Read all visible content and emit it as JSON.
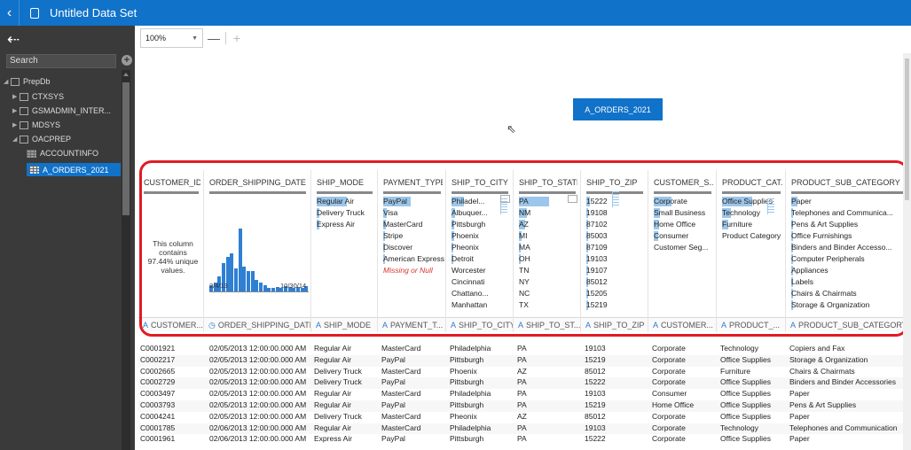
{
  "window": {
    "title": "Untitled Data Set"
  },
  "left_panel": {
    "search_placeholder": "Search",
    "tree": [
      {
        "label": "PrepDb",
        "type": "db",
        "expanded": true
      },
      {
        "label": "CTXSYS",
        "type": "schema"
      },
      {
        "label": "GSMADMIN_INTER...",
        "type": "schema"
      },
      {
        "label": "MDSYS",
        "type": "schema"
      },
      {
        "label": "OACPREP",
        "type": "schema",
        "expanded": true
      },
      {
        "label": "ACCOUNTINFO",
        "type": "table"
      },
      {
        "label": "A_ORDERS_2021",
        "type": "table",
        "selected": true
      }
    ]
  },
  "toolbar": {
    "zoom": "100%",
    "zoom_out": "—",
    "zoom_in": "+"
  },
  "diagram": {
    "node_label": "A_ORDERS_2021"
  },
  "profile": {
    "columns": [
      {
        "header": "CUSTOMER_ID",
        "footer": "CUSTOMER...",
        "type_icon": "A",
        "unique_note": "This column contains 97.44% unique values."
      },
      {
        "header": "ORDER_SHIPPING_DATE",
        "footer": "ORDER_SHIPPING_DATE",
        "type_icon": "◷",
        "histogram": {
          "start_label": "2/4/13",
          "end_label": "10/30/14",
          "values": [
            0.1,
            0.14,
            0.24,
            0.44,
            0.52,
            0.58,
            0.36,
            0.95,
            0.38,
            0.31,
            0.31,
            0.18,
            0.14,
            0.1,
            0.06,
            0.06,
            0.08,
            0.07,
            0.09,
            0.08,
            0.07,
            0.08,
            0.06,
            0.09
          ]
        }
      },
      {
        "header": "SHIP_MODE",
        "footer": "SHIP_MODE",
        "type_icon": "A",
        "values": [
          {
            "label": "Regular Air",
            "frac": 1.0
          },
          {
            "label": "Delivery Truck",
            "frac": 0.1
          },
          {
            "label": "Express Air",
            "frac": 0.08
          }
        ]
      },
      {
        "header": "PAYMENT_TYPE",
        "footer": "PAYMENT_T...",
        "type_icon": "A",
        "values": [
          {
            "label": "PayPal",
            "frac": 0.92
          },
          {
            "label": "Visa",
            "frac": 0.12
          },
          {
            "label": "MasterCard",
            "frac": 0.08
          },
          {
            "label": "Stripe",
            "frac": 0.07
          },
          {
            "label": "Discover",
            "frac": 0.05
          },
          {
            "label": "American Express",
            "frac": 0.04
          },
          {
            "label": "Missing or Null",
            "frac": 0,
            "missing": true
          }
        ]
      },
      {
        "header": "SHIP_TO_CITY",
        "footer": "SHIP_TO_CITY",
        "type_icon": "A",
        "values": [
          {
            "label": "Philadel...",
            "frac": 0.4
          },
          {
            "label": "Albuquer...",
            "frac": 0.12
          },
          {
            "label": "Pittsburgh",
            "frac": 0.1
          },
          {
            "label": "Phoenix",
            "frac": 0.08
          },
          {
            "label": "Pheonix",
            "frac": 0.06
          },
          {
            "label": "Detroit",
            "frac": 0.05
          },
          {
            "label": "Worcester",
            "frac": 0
          },
          {
            "label": "Cincinnati",
            "frac": 0
          },
          {
            "label": "Chattano...",
            "frac": 0
          },
          {
            "label": "Manhattan",
            "frac": 0
          }
        ]
      },
      {
        "header": "SHIP_TO_STATE",
        "footer": "SHIP_TO_ST...",
        "type_icon": "A",
        "values": [
          {
            "label": "PA",
            "frac": 1.0
          },
          {
            "label": "NM",
            "frac": 0.25
          },
          {
            "label": "AZ",
            "frac": 0.2
          },
          {
            "label": "MI",
            "frac": 0.1
          },
          {
            "label": "MA",
            "frac": 0.07
          },
          {
            "label": "OH",
            "frac": 0.06
          },
          {
            "label": "TN",
            "frac": 0
          },
          {
            "label": "NY",
            "frac": 0
          },
          {
            "label": "NC",
            "frac": 0
          },
          {
            "label": "TX",
            "frac": 0
          }
        ]
      },
      {
        "header": "SHIP_TO_ZIP",
        "footer": "SHIP_TO_ZIP",
        "type_icon": "A",
        "values": [
          {
            "label": "15222",
            "frac": 0.12
          },
          {
            "label": "19108",
            "frac": 0.06
          },
          {
            "label": "87102",
            "frac": 0.05
          },
          {
            "label": "85003",
            "frac": 0.04
          },
          {
            "label": "87109",
            "frac": 0.04
          },
          {
            "label": "19103",
            "frac": 0.03
          },
          {
            "label": "19107",
            "frac": 0.03
          },
          {
            "label": "85012",
            "frac": 0.03
          },
          {
            "label": "15205",
            "frac": 0.02
          },
          {
            "label": "15219",
            "frac": 0.02
          }
        ]
      },
      {
        "header": "CUSTOMER_S...",
        "footer": "CUSTOMER...",
        "type_icon": "A",
        "values": [
          {
            "label": "Corporate",
            "frac": 0.6
          },
          {
            "label": "Small Business",
            "frac": 0.2
          },
          {
            "label": "Home Office",
            "frac": 0.18
          },
          {
            "label": "Consumer",
            "frac": 0.16
          },
          {
            "label": "Customer Seg...",
            "frac": 0
          }
        ]
      },
      {
        "header": "PRODUCT_CAT...",
        "footer": "PRODUCT_...",
        "type_icon": "A",
        "values": [
          {
            "label": "Office Supplies",
            "frac": 1.0
          },
          {
            "label": "Technology",
            "frac": 0.3
          },
          {
            "label": "Furniture",
            "frac": 0.22
          },
          {
            "label": "Product Category",
            "frac": 0
          }
        ]
      },
      {
        "header": "PRODUCT_SUB_CATEGORY",
        "footer": "PRODUCT_SUB_CATEGORY",
        "type_icon": "A",
        "values": [
          {
            "label": "Paper",
            "frac": 0.22
          },
          {
            "label": "Telephones and Communica...",
            "frac": 0.06
          },
          {
            "label": "Pens & Art Supplies",
            "frac": 0.05
          },
          {
            "label": "Office Furnishings",
            "frac": 0.05
          },
          {
            "label": "Binders and Binder Accesso...",
            "frac": 0.04
          },
          {
            "label": "Computer Peripherals",
            "frac": 0.04
          },
          {
            "label": "Appliances",
            "frac": 0.03
          },
          {
            "label": "Labels",
            "frac": 0.03
          },
          {
            "label": "Chairs & Chairmats",
            "frac": 0.03
          },
          {
            "label": "Storage & Organization",
            "frac": 0.03
          }
        ]
      }
    ]
  },
  "table": {
    "rows": [
      [
        "C0001921",
        "02/05/2013 12:00:00.000 AM",
        "Regular Air",
        "MasterCard",
        "Philadelphia",
        "PA",
        "19103",
        "Corporate",
        "Technology",
        "Copiers and Fax"
      ],
      [
        "C0002217",
        "02/05/2013 12:00:00.000 AM",
        "Regular Air",
        "PayPal",
        "Pittsburgh",
        "PA",
        "15219",
        "Corporate",
        "Office Supplies",
        "Storage & Organization"
      ],
      [
        "C0002665",
        "02/05/2013 12:00:00.000 AM",
        "Delivery Truck",
        "MasterCard",
        "Phoenix",
        "AZ",
        "85012",
        "Corporate",
        "Furniture",
        "Chairs & Chairmats"
      ],
      [
        "C0002729",
        "02/05/2013 12:00:00.000 AM",
        "Delivery Truck",
        "PayPal",
        "Pittsburgh",
        "PA",
        "15222",
        "Corporate",
        "Office Supplies",
        "Binders and Binder Accessories"
      ],
      [
        "C0003497",
        "02/05/2013 12:00:00.000 AM",
        "Regular Air",
        "MasterCard",
        "Philadelphia",
        "PA",
        "19103",
        "Consumer",
        "Office Supplies",
        "Paper"
      ],
      [
        "C0003793",
        "02/05/2013 12:00:00.000 AM",
        "Regular Air",
        "PayPal",
        "Pittsburgh",
        "PA",
        "15219",
        "Home Office",
        "Office Supplies",
        "Pens & Art Supplies"
      ],
      [
        "C0004241",
        "02/05/2013 12:00:00.000 AM",
        "Delivery Truck",
        "MasterCard",
        "Pheonix",
        "AZ",
        "85012",
        "Corporate",
        "Office Supplies",
        "Paper"
      ],
      [
        "C0001785",
        "02/06/2013 12:00:00.000 AM",
        "Regular Air",
        "MasterCard",
        "Philadelphia",
        "PA",
        "19103",
        "Corporate",
        "Technology",
        "Telephones and Communication"
      ],
      [
        "C0001961",
        "02/06/2013 12:00:00.000 AM",
        "Express Air",
        "PayPal",
        "Pittsburgh",
        "PA",
        "15222",
        "Corporate",
        "Office Supplies",
        "Paper"
      ]
    ]
  }
}
